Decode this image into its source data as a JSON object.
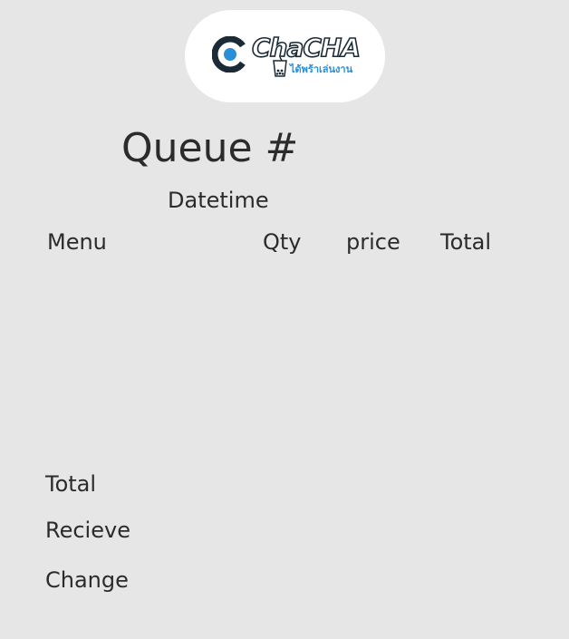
{
  "logo": {
    "brand": "ChaCHA",
    "tagline": "ได้พร้าเล่นงาน",
    "icon": "chacha-logo-icon",
    "colors": {
      "dark": "#1c2a36",
      "accent": "#2a8fd6"
    }
  },
  "receipt": {
    "queue_label": "Queue #",
    "datetime_label": "Datetime",
    "columns": {
      "menu": "Menu",
      "qty": "Qty",
      "price": "price",
      "total": "Total"
    },
    "items": [],
    "summary": {
      "total_label": "Total",
      "receive_label": "Recieve",
      "change_label": "Change"
    }
  }
}
